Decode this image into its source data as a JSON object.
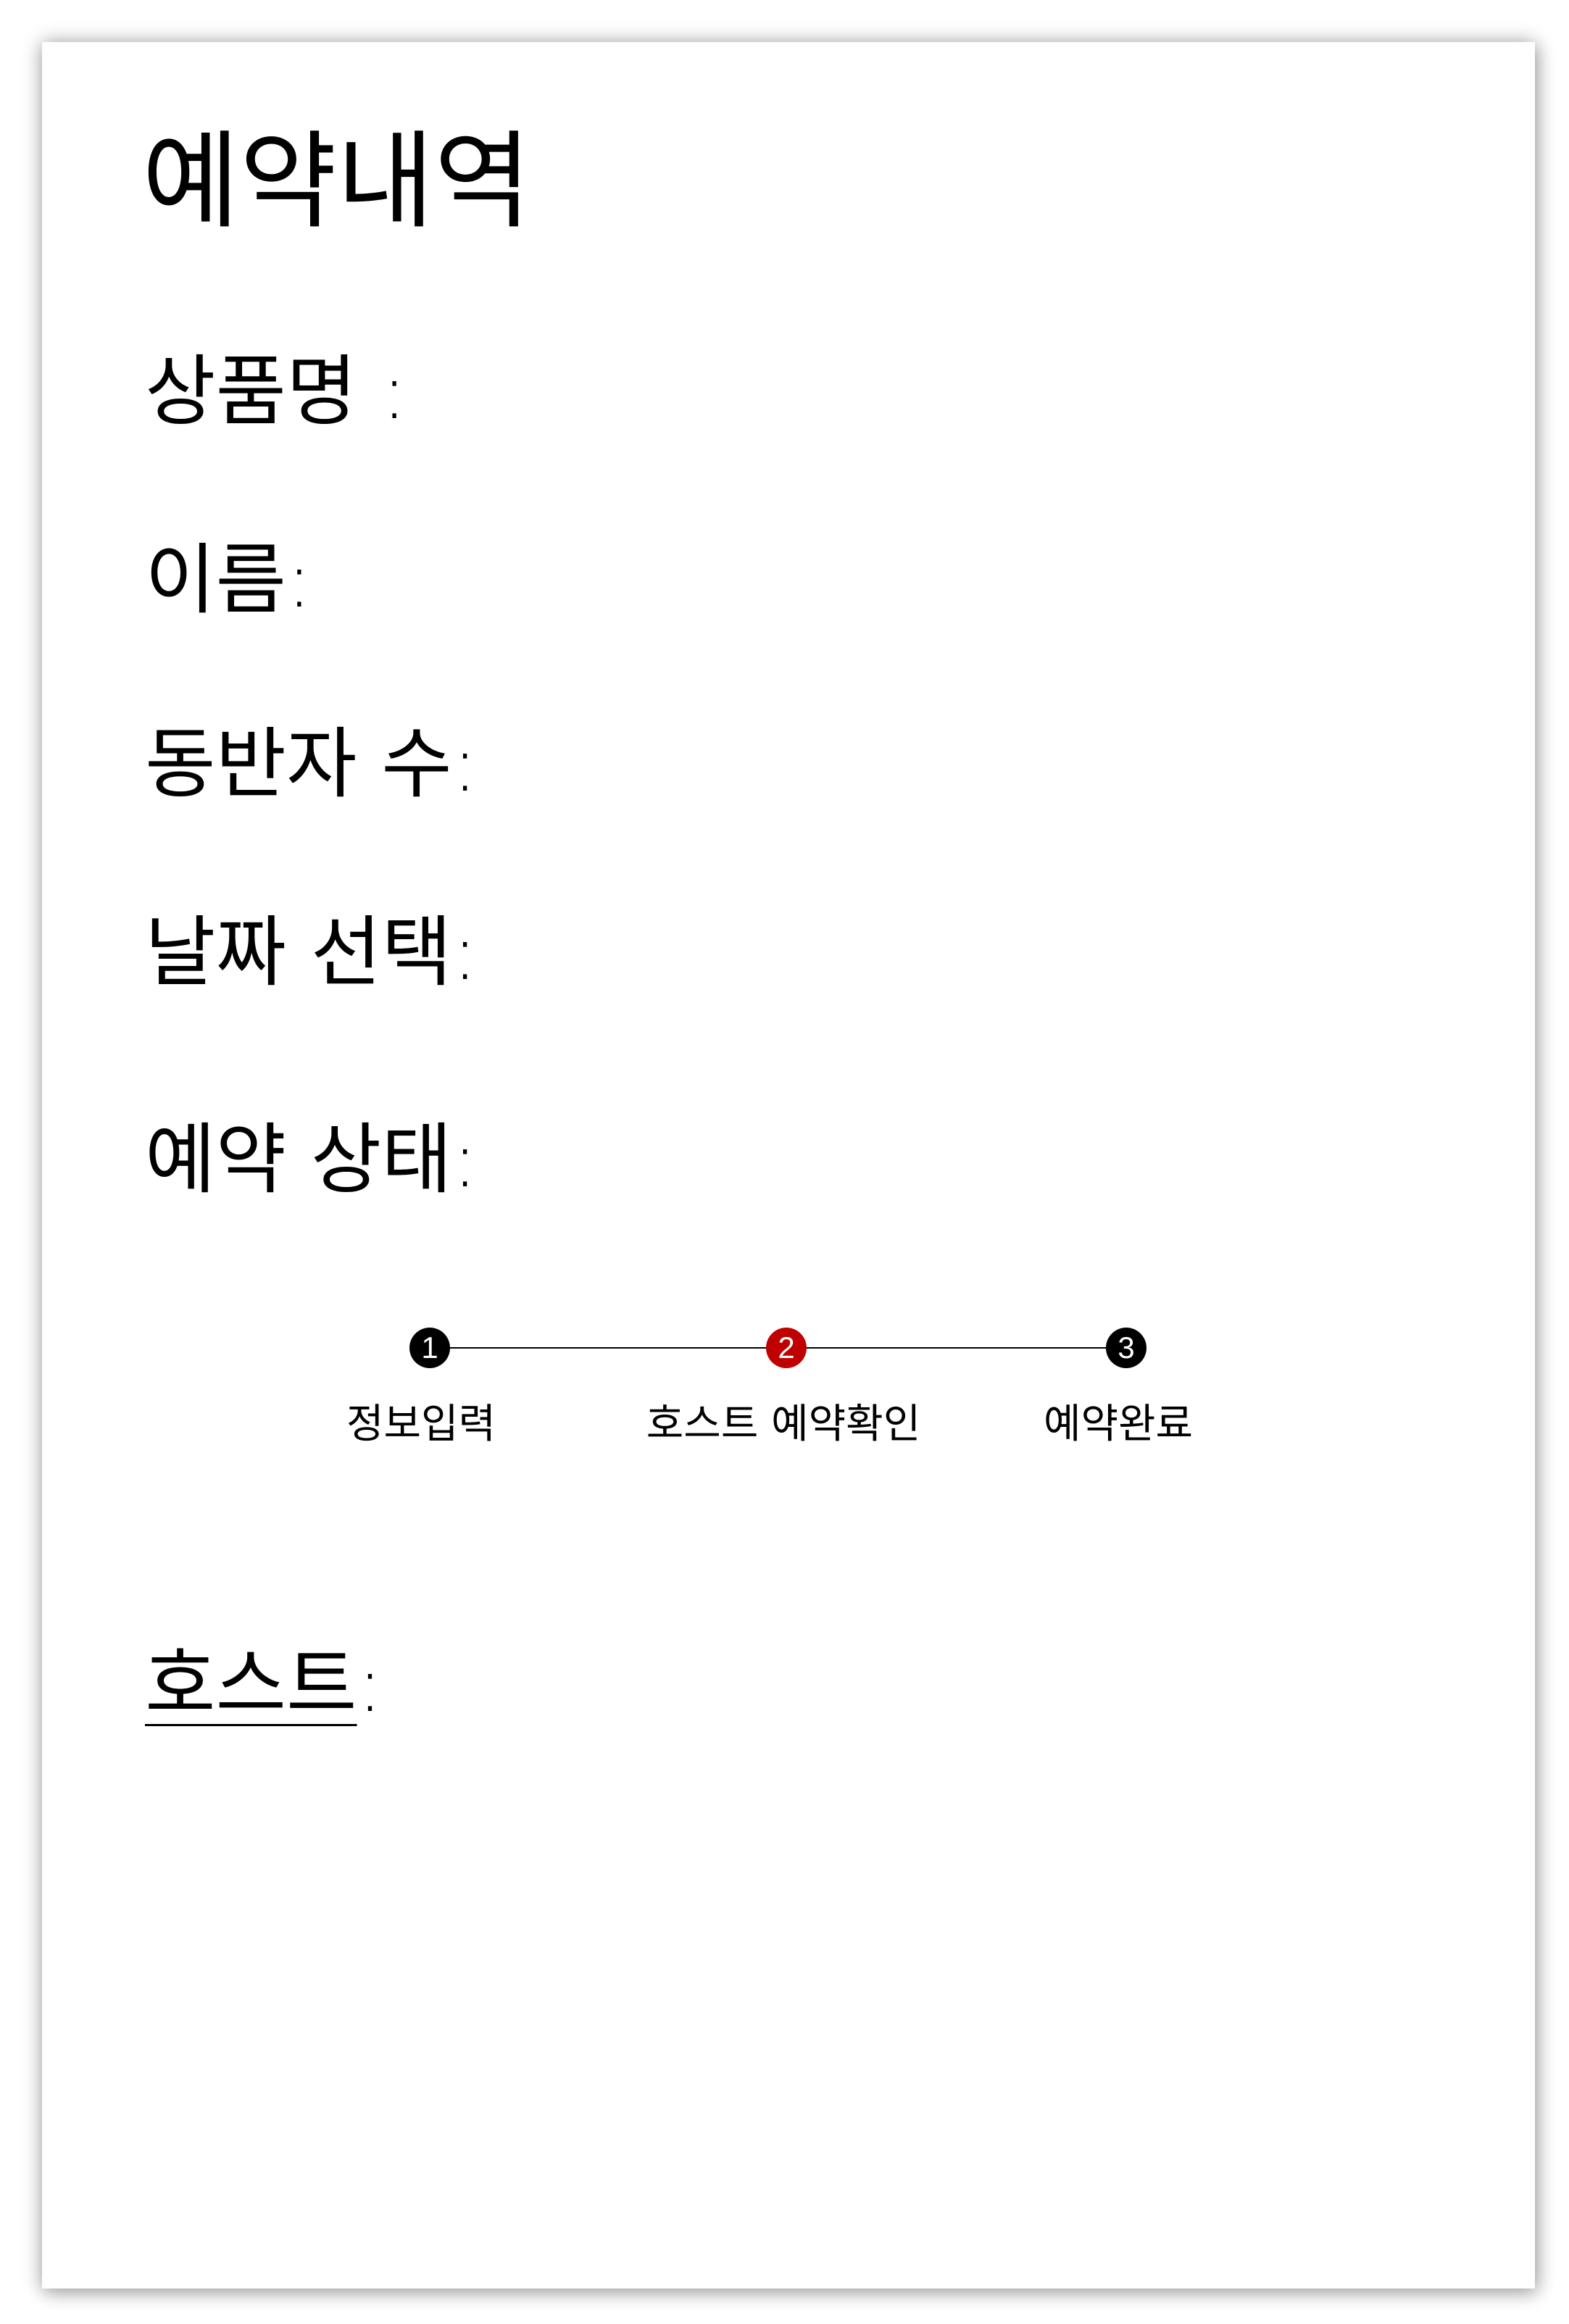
{
  "page": {
    "title": "예약내역"
  },
  "fields": {
    "product": "상품명 :",
    "name": "이름:",
    "guests": "동반자 수:",
    "date": "날짜 선택:",
    "status": "예약 상태:",
    "host": "호스트",
    "host_colon": ":"
  },
  "progress": {
    "current_step": 2,
    "steps": [
      {
        "number": "1",
        "label": "정보입력",
        "color": "#000000"
      },
      {
        "number": "2",
        "label": "호스트 예약확인",
        "color": "#c00000"
      },
      {
        "number": "3",
        "label": "예약완료",
        "color": "#000000"
      }
    ]
  },
  "colors": {
    "background": "#ffffff",
    "text": "#000000",
    "active_step": "#c00000"
  }
}
